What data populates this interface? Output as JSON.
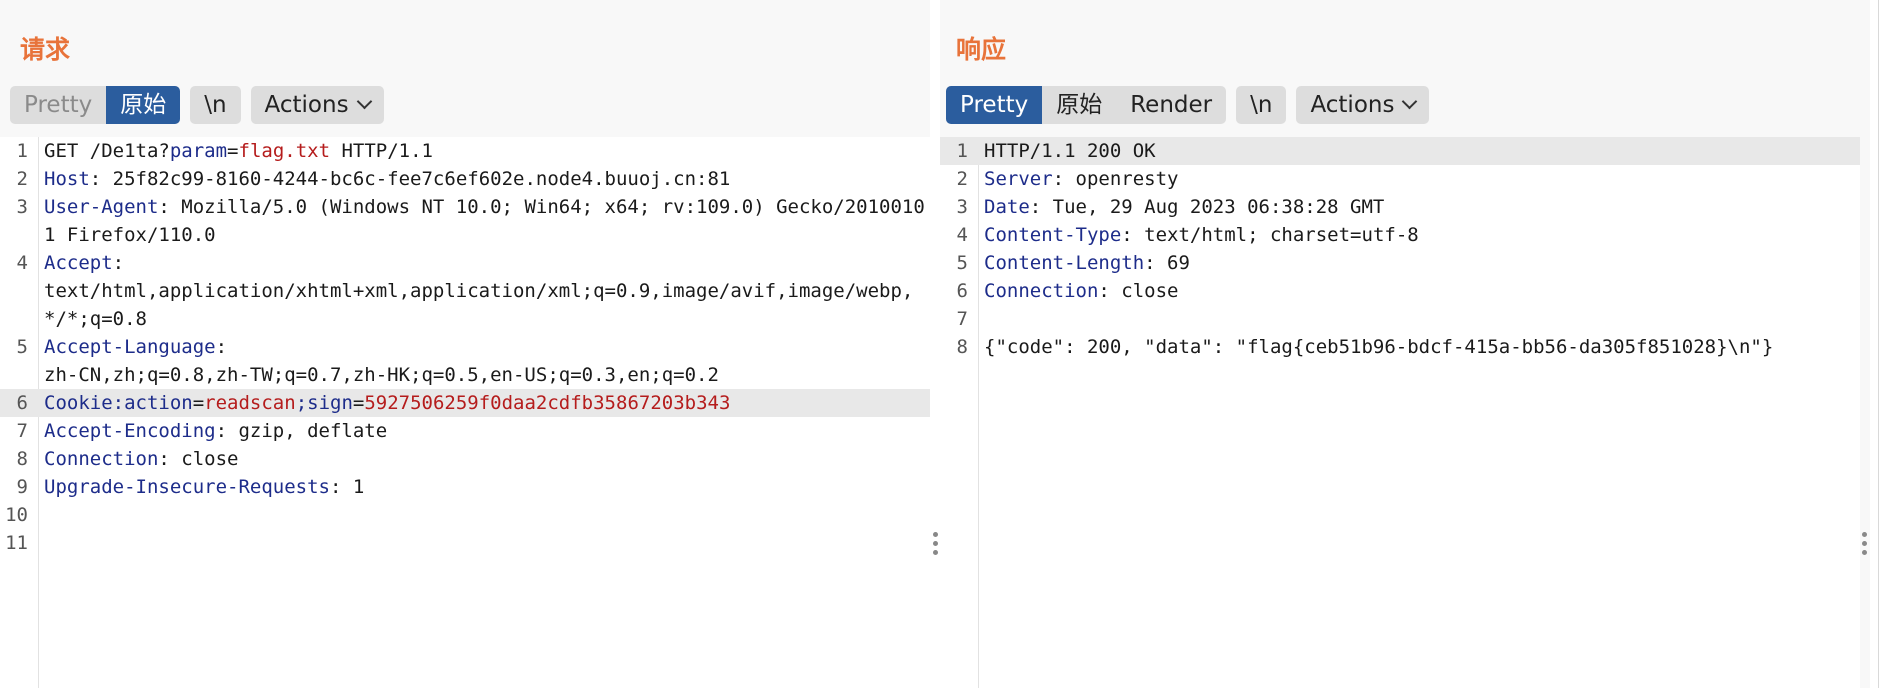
{
  "request": {
    "title": "请求",
    "tabs": [
      "Pretty",
      "原始"
    ],
    "newline_label": "\\n",
    "actions_label": "Actions",
    "lines": [
      {
        "n": "1",
        "parts": [
          [
            "t",
            "GET /De1ta?"
          ],
          [
            "k",
            "param"
          ],
          [
            "t",
            "="
          ],
          [
            "v",
            "flag.txt"
          ],
          [
            "t",
            " HTTP/1.1"
          ]
        ]
      },
      {
        "n": "2",
        "parts": [
          [
            "k",
            "Host"
          ],
          [
            "t",
            ": 25f82c99-8160-4244-bc6c-fee7c6ef602e.node4.buuoj.cn:81"
          ]
        ]
      },
      {
        "n": "3",
        "parts": [
          [
            "k",
            "User-Agent"
          ],
          [
            "t",
            ": Mozilla/5.0 (Windows NT 10.0; Win64; x64; rv:109.0) Gecko/20100101 Firefox/110.0"
          ]
        ]
      },
      {
        "n": "4",
        "parts": [
          [
            "k",
            "Accept"
          ],
          [
            "t",
            ":\ntext/html,application/xhtml+xml,application/xml;q=0.9,image/avif,image/webp,*/*;q=0.8"
          ]
        ]
      },
      {
        "n": "5",
        "parts": [
          [
            "k",
            "Accept-Language"
          ],
          [
            "t",
            ":\nzh-CN,zh;q=0.8,zh-TW;q=0.7,zh-HK;q=0.5,en-US;q=0.3,en;q=0.2"
          ]
        ]
      },
      {
        "n": "6",
        "hl": true,
        "parts": [
          [
            "k",
            "Cookie:action"
          ],
          [
            "t",
            "="
          ],
          [
            "v",
            "readscan"
          ],
          [
            "k",
            ";sign"
          ],
          [
            "t",
            "="
          ],
          [
            "v",
            "5927506259f0daa2cdfb35867203b343"
          ]
        ]
      },
      {
        "n": "7",
        "parts": [
          [
            "k",
            "Accept-Encoding"
          ],
          [
            "t",
            ": gzip, deflate"
          ]
        ]
      },
      {
        "n": "8",
        "parts": [
          [
            "k",
            "Connection"
          ],
          [
            "t",
            ": close"
          ]
        ]
      },
      {
        "n": "9",
        "parts": [
          [
            "k",
            "Upgrade-Insecure-Requests"
          ],
          [
            "t",
            ": 1"
          ]
        ]
      },
      {
        "n": "10",
        "parts": []
      },
      {
        "n": "11",
        "parts": []
      }
    ]
  },
  "response": {
    "title": "响应",
    "tabs": [
      "Pretty",
      "原始",
      "Render"
    ],
    "newline_label": "\\n",
    "actions_label": "Actions",
    "lines": [
      {
        "n": "1",
        "hl": true,
        "parts": [
          [
            "t",
            "HTTP/1.1 200 OK"
          ]
        ]
      },
      {
        "n": "2",
        "parts": [
          [
            "k",
            "Server"
          ],
          [
            "t",
            ": openresty"
          ]
        ]
      },
      {
        "n": "3",
        "parts": [
          [
            "k",
            "Date"
          ],
          [
            "t",
            ": Tue, 29 Aug 2023 06:38:28 GMT"
          ]
        ]
      },
      {
        "n": "4",
        "parts": [
          [
            "k",
            "Content-Type"
          ],
          [
            "t",
            ": text/html; charset=utf-8"
          ]
        ]
      },
      {
        "n": "5",
        "parts": [
          [
            "k",
            "Content-Length"
          ],
          [
            "t",
            ": 69"
          ]
        ]
      },
      {
        "n": "6",
        "parts": [
          [
            "k",
            "Connection"
          ],
          [
            "t",
            ": close"
          ]
        ]
      },
      {
        "n": "7",
        "parts": []
      },
      {
        "n": "8",
        "parts": [
          [
            "t",
            "{\"code\": 200, \"data\": \"flag{ceb51b96-bdcf-415a-bb56-da305f851028}\\n\"}"
          ]
        ]
      }
    ]
  },
  "view_switcher": {
    "options": [
      "side-by-side-icon",
      "stacked-icon",
      "single-icon"
    ],
    "active": 0
  },
  "colors": {
    "accent": "#2b5d9e",
    "title": "#e8733a",
    "header_key": "#1d2c8a",
    "value": "#b51c1c"
  }
}
